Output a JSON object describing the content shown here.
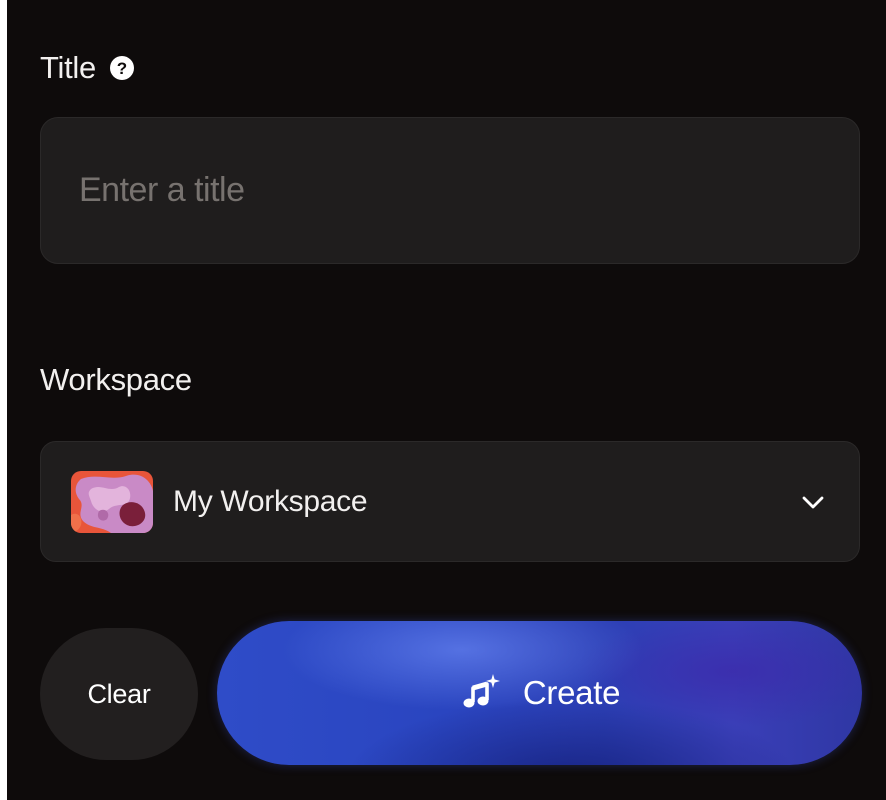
{
  "form": {
    "title_label": "Title",
    "title_placeholder": "Enter a title",
    "title_value": "",
    "workspace_label": "Workspace",
    "workspace_selected": "My Workspace"
  },
  "actions": {
    "clear_label": "Clear",
    "create_label": "Create"
  },
  "icons": {
    "help": "help-circle-icon",
    "chevron": "chevron-down-icon",
    "create": "music-sparkle-icon"
  },
  "colors": {
    "background": "#0e0b0b",
    "field_bg": "#1f1d1d",
    "placeholder": "#77726f",
    "accent_blue": "#2c46c4"
  }
}
